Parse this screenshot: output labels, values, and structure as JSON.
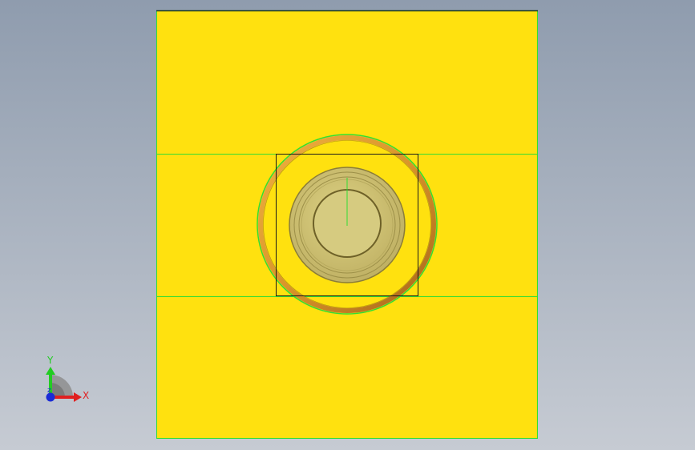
{
  "viewport": {
    "background_top": "#8f9cae",
    "background_bottom": "#c6cbd3",
    "part_color": "#ffe10f",
    "edge_highlight_color": "#33dd33",
    "ring_color": "#d9952a",
    "boss_color": "#d2c67a",
    "sketch_line_color": "#1a1a1a"
  },
  "triad": {
    "y_label": "Y",
    "x_label": "X",
    "y_color": "#22cc22",
    "x_color": "#e02020",
    "z_color": "#1a2bd6"
  }
}
